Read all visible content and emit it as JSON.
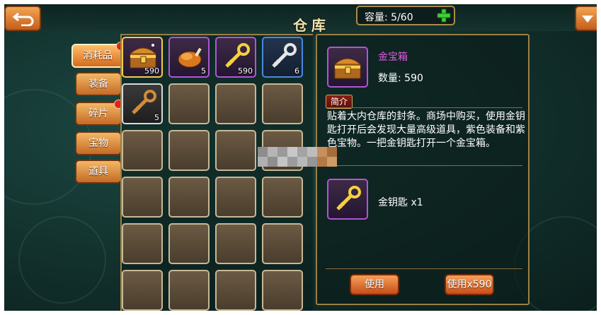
{
  "header": {
    "title": "仓库",
    "capacity_label": "容量: 5/60"
  },
  "tabs": [
    {
      "label": "消耗品",
      "active": true,
      "has_alert": true
    },
    {
      "label": "装备",
      "active": false,
      "has_alert": false
    },
    {
      "label": "碎片",
      "active": false,
      "has_alert": true
    },
    {
      "label": "宝物",
      "active": false,
      "has_alert": false
    },
    {
      "label": "道具",
      "active": false,
      "has_alert": false
    }
  ],
  "inventory": {
    "items": [
      {
        "icon": "gold-chest-icon",
        "count": "590",
        "rarity": "purple",
        "selected": true
      },
      {
        "icon": "roast-chicken-icon",
        "count": "5",
        "rarity": "purple",
        "selected": false
      },
      {
        "icon": "gold-key-icon",
        "count": "590",
        "rarity": "purple",
        "selected": false
      },
      {
        "icon": "silver-key-icon",
        "count": "6",
        "rarity": "blue",
        "selected": false
      },
      {
        "icon": "bronze-key-icon",
        "count": "5",
        "rarity": "white",
        "selected": false
      }
    ]
  },
  "detail": {
    "name": "金宝箱",
    "quantity_label": "数量: 590",
    "intro_label": "简介",
    "description": "贴着大内仓库的封条。商场中购买，使用金钥匙打开后会发现大量高级道具，紫色装备和紫色宝物。一把金钥匙打开一个金宝箱。",
    "requirement": "金钥匙 x1",
    "use_label": "使用",
    "use_all_label": "使用x590"
  },
  "colors": {
    "purple_rarity": "#b055d6",
    "blue_rarity": "#4a88e0",
    "name_color": "#e15ae6",
    "button_orange": "#d8641e",
    "alert_red": "#e0241c"
  }
}
